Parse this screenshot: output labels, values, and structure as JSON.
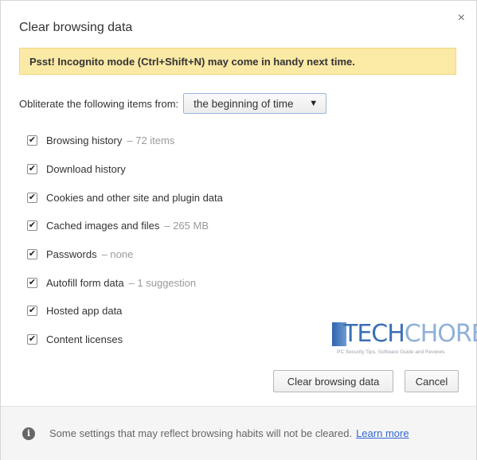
{
  "dialog": {
    "title": "Clear browsing data",
    "close_glyph": "×"
  },
  "banner": {
    "text": "Psst! Incognito mode (Ctrl+Shift+N) may come in handy next time."
  },
  "range": {
    "label": "Obliterate the following items from:",
    "selected": "the beginning of time",
    "arrow": "▼"
  },
  "items": [
    {
      "label": "Browsing history",
      "meta": "– 72 items",
      "checked": true
    },
    {
      "label": "Download history",
      "meta": "",
      "checked": true
    },
    {
      "label": "Cookies and other site and plugin data",
      "meta": "",
      "checked": true
    },
    {
      "label": "Cached images and files",
      "meta": "– 265 MB",
      "checked": true
    },
    {
      "label": "Passwords",
      "meta": "– none",
      "checked": true
    },
    {
      "label": "Autofill form data",
      "meta": "– 1 suggestion",
      "checked": true
    },
    {
      "label": "Hosted app data",
      "meta": "",
      "checked": true
    },
    {
      "label": "Content licenses",
      "meta": "",
      "checked": true
    }
  ],
  "check_glyph": "✔",
  "watermark": {
    "word_a": "TECH",
    "word_b": "CHORE",
    "tagline": "PC Security Tips, Software Guide and Reviews"
  },
  "buttons": {
    "clear": "Clear browsing data",
    "cancel": "Cancel"
  },
  "footer": {
    "info_glyph": "i",
    "text": "Some settings that may reflect browsing habits will not be cleared.",
    "link": "Learn more"
  },
  "colors": {
    "banner_bg": "#fbe9a6",
    "link": "#3367d6",
    "select_border": "#9ab5e0"
  },
  "icons": {
    "close": "close-icon",
    "dropdown": "chevron-down-icon",
    "checkbox": "checkmark-icon",
    "info": "info-icon"
  }
}
